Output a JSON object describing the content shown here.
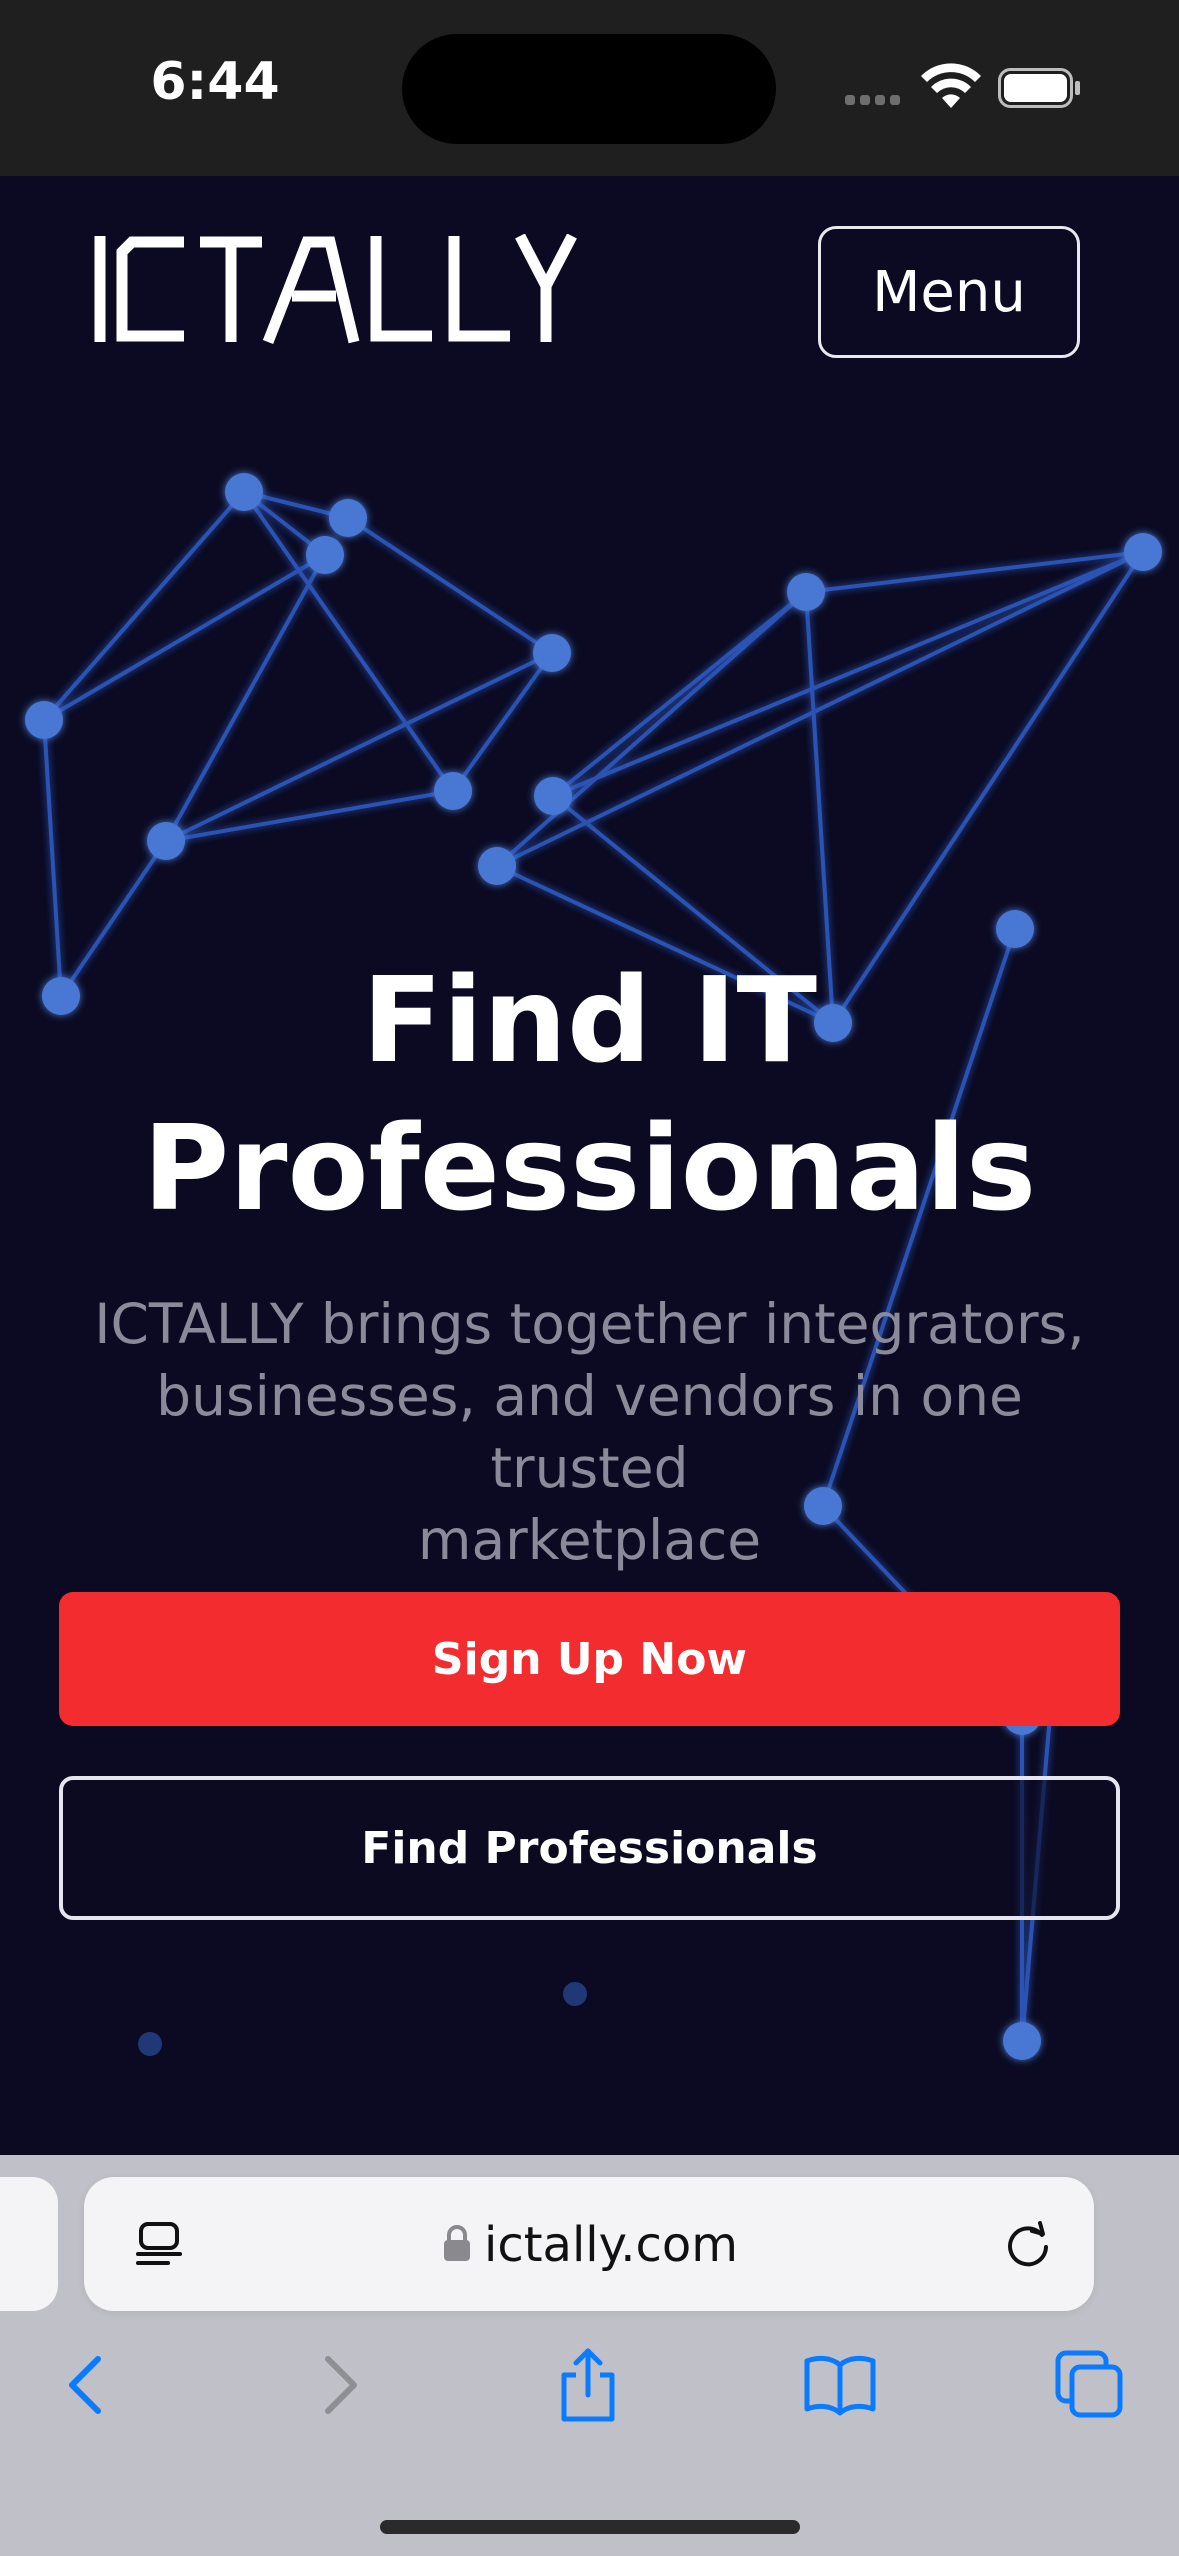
{
  "status_bar": {
    "time": "6:44"
  },
  "header": {
    "logo_text": "ICTALLY",
    "menu_label": "Menu"
  },
  "hero": {
    "headline_line1": "Find IT",
    "headline_line2": "Professionals",
    "subtext_line1": "ICTALLY brings together integrators,",
    "subtext_line2": "businesses, and vendors in one trusted",
    "subtext_line3": "marketplace"
  },
  "actions": {
    "signup_label": "Sign Up Now",
    "find_label": "Find Professionals"
  },
  "browser": {
    "url": "ictally.com",
    "toolbar_icons": [
      "back-icon",
      "forward-icon",
      "share-icon",
      "bookmarks-icon",
      "tabs-icon"
    ]
  },
  "colors": {
    "background": "#0b0a22",
    "accent_red": "#f22c2f",
    "network_node": "#4a78d4",
    "browser_blue": "#0a7aff"
  }
}
